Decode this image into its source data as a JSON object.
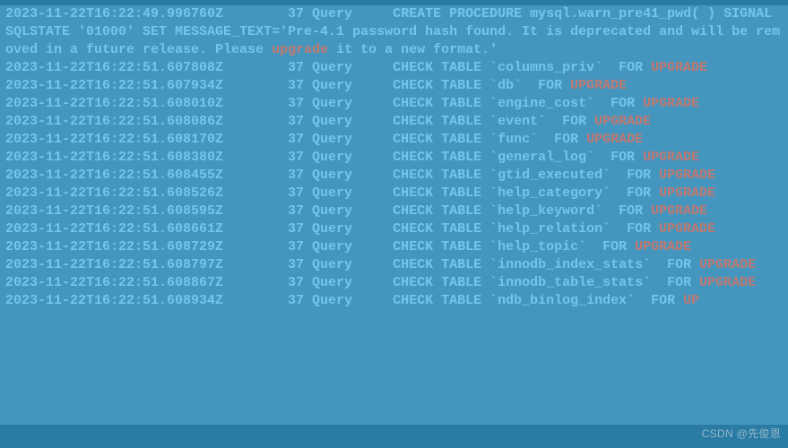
{
  "watermark": "CSDN @先俊恩",
  "thread": "37",
  "cmd": "Query",
  "kw_upgrade_lc": "upgrade",
  "kw_upgrade": "UPGRADE",
  "kw_upgrad": "UPGRAD",
  "kw_upgra": "UPGRA",
  "kw_up": "UP",
  "tail_e": "E",
  "tail_de": "DE",
  "tail_grade": "GRADE",
  "lines": {
    "l0a": "2023-11-22T16:22:49.996760Z        37 Query     CREATE PROCEDURE mysql.warn_pre41_pwd( ) SIGNAL SQLSTATE '01000' SET MESSAGE_TEXT='Pre-4.1 password hash found. It is deprecated and will be removed in a future release. Please ",
    "l0b": " it to a new format.'",
    "l1": "2023-11-22T16:22:51.607808Z        37 Query     CHECK TABLE `columns_priv`  FOR ",
    "l2": "2023-11-22T16:22:51.607934Z        37 Query     CHECK TABLE `db`  FOR ",
    "l3": "2023-11-22T16:22:51.608010Z        37 Query     CHECK TABLE `engine_cost`  FOR ",
    "l4": "2023-11-22T16:22:51.608086Z        37 Query     CHECK TABLE `event`  FOR ",
    "l5": "2023-11-22T16:22:51.608170Z        37 Query     CHECK TABLE `func`  FOR ",
    "l6": "2023-11-22T16:22:51.608380Z        37 Query     CHECK TABLE `general_log`  FOR ",
    "l7": "2023-11-22T16:22:51.608455Z        37 Query     CHECK TABLE `gtid_executed`  FOR ",
    "l8": "2023-11-22T16:22:51.608526Z        37 Query     CHECK TABLE `help_category`  FOR ",
    "l9": "2023-11-22T16:22:51.608595Z        37 Query     CHECK TABLE `help_keyword`  FOR ",
    "l10": "2023-11-22T16:22:51.608661Z        37 Query     CHECK TABLE `help_relation`  FOR ",
    "l11": "2023-11-22T16:22:51.608729Z        37 Query     CHECK TABLE `help_topic`  FOR ",
    "l12": "2023-11-22T16:22:51.608797Z        37 Query     CHECK TABLE `innodb_index_stats`  FOR ",
    "l13": "2023-11-22T16:22:51.608867Z        37 Query     CHECK TABLE `innodb_table_stats`  FOR ",
    "l14": "2023-11-22T16:22:51.608934Z        37 Query     CHECK TABLE `ndb_binlog_index`  FOR "
  }
}
